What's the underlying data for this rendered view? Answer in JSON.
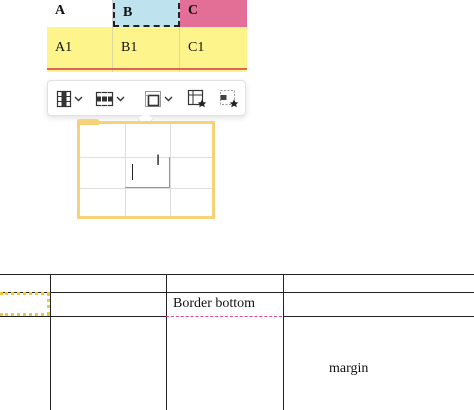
{
  "top_table": {
    "headers": [
      "A",
      "B",
      "C"
    ],
    "cells": [
      "A1",
      "B1",
      "C1"
    ]
  },
  "toolbar": {
    "buttons": [
      {
        "icon": "insert-column-icon",
        "has_dropdown": true
      },
      {
        "icon": "insert-row-icon",
        "has_dropdown": true
      },
      {
        "icon": "merge-cells-icon",
        "has_dropdown": true
      },
      {
        "icon": "table-properties-icon",
        "has_dropdown": false
      },
      {
        "icon": "cell-properties-icon",
        "has_dropdown": false
      }
    ]
  },
  "doc_table": {
    "cells": {
      "border_bottom": "Border bottom",
      "margin": "margin"
    }
  },
  "colors": {
    "yellow_cell": "#fdf58b",
    "blue_header": "#bfe2ef",
    "pink_header": "#e36f96",
    "selection_yellow": "#f5d27a",
    "border_bottom_pink": "#d64b8a"
  }
}
